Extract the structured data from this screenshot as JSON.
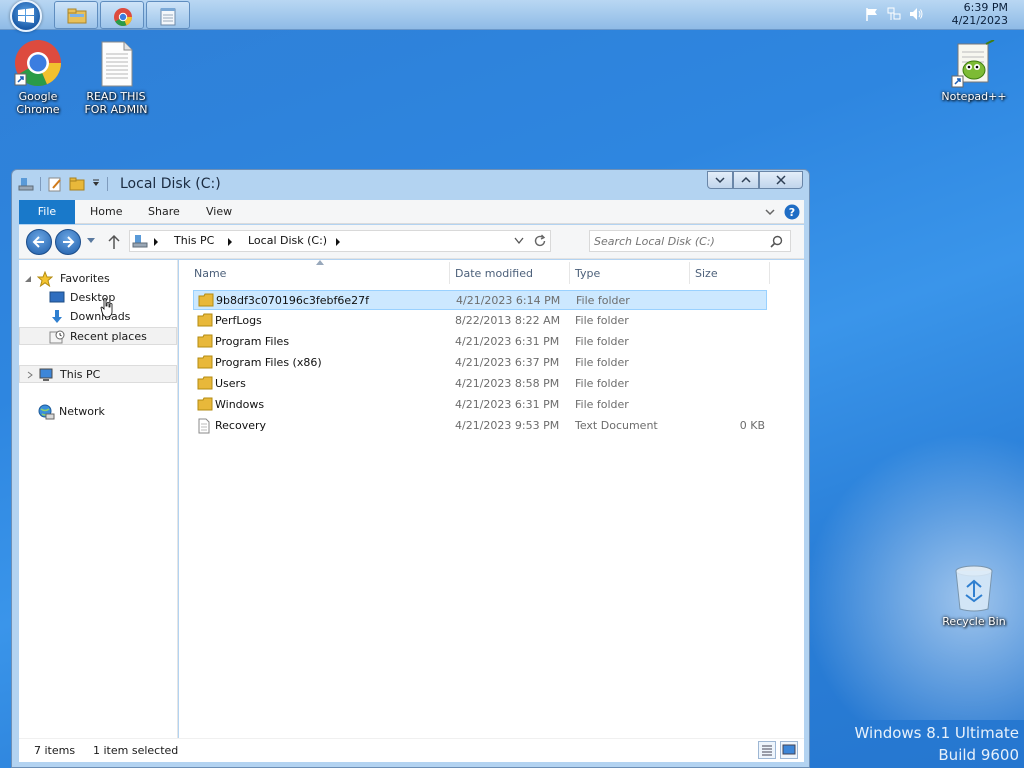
{
  "taskbar": {
    "clock": {
      "time": "6:39 PM",
      "date": "4/21/2023"
    },
    "pinned": [
      {
        "name": "file-explorer-icon"
      },
      {
        "name": "chrome-icon"
      },
      {
        "name": "notepad-icon"
      }
    ],
    "tray_icons": [
      "flag-icon",
      "network-icon",
      "volume-icon"
    ]
  },
  "desktop": {
    "icons": [
      {
        "label": "Google Chrome"
      },
      {
        "label": "READ THIS FOR ADMIN"
      },
      {
        "label": "Notepad++"
      },
      {
        "label": "Recycle Bin"
      }
    ],
    "watermark": {
      "line1": "Windows 8.1 Ultimate",
      "line2": "Build 9600"
    }
  },
  "window": {
    "title": "Local Disk (C:)",
    "ribbon_tabs": [
      "File",
      "Home",
      "Share",
      "View"
    ],
    "breadcrumbs": [
      "This PC",
      "Local Disk (C:)"
    ],
    "search_placeholder": "Search Local Disk (C:)",
    "nav": {
      "favorites": "Favorites",
      "items": [
        "Desktop",
        "Downloads",
        "Recent places"
      ],
      "this_pc": "This PC",
      "network": "Network"
    },
    "columns": [
      "Name",
      "Date modified",
      "Type",
      "Size"
    ],
    "rows": [
      {
        "name": "9b8df3c070196c3febf6e27f",
        "date": "4/21/2023 6:14 PM",
        "type": "File folder",
        "size": "",
        "selected": true
      },
      {
        "name": "PerfLogs",
        "date": "8/22/2013 8:22 AM",
        "type": "File folder",
        "size": ""
      },
      {
        "name": "Program Files",
        "date": "4/21/2023 6:31 PM",
        "type": "File folder",
        "size": ""
      },
      {
        "name": "Program Files (x86)",
        "date": "4/21/2023 6:37 PM",
        "type": "File folder",
        "size": ""
      },
      {
        "name": "Users",
        "date": "4/21/2023 8:58 PM",
        "type": "File folder",
        "size": ""
      },
      {
        "name": "Windows",
        "date": "4/21/2023 6:31 PM",
        "type": "File folder",
        "size": ""
      },
      {
        "name": "Recovery",
        "date": "4/21/2023 9:53 PM",
        "type": "Text Document",
        "size": "0 KB"
      }
    ],
    "status": {
      "count": "7 items",
      "selection": "1 item selected"
    }
  },
  "colors": {
    "accent": "#1979ca",
    "selection_bg": "#cce8ff",
    "selection_border": "#99d1ff",
    "folder": "#e8b83a"
  }
}
